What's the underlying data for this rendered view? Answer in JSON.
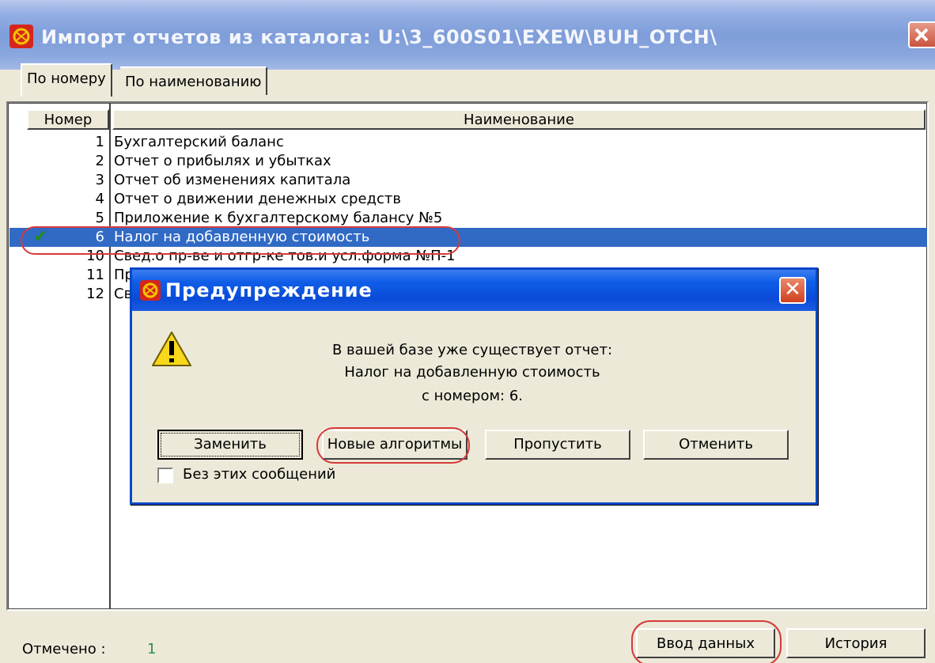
{
  "window": {
    "title": "Импорт отчетов из каталога:  U:\\3_600S01\\EXEW\\BUH_OTCH\\"
  },
  "tabs": [
    {
      "label": "По номеру",
      "active": true
    },
    {
      "label": "По наименованию",
      "active": false
    }
  ],
  "list": {
    "columns": [
      "Номер",
      "Наименование"
    ],
    "rows": [
      {
        "num": "1",
        "name": "Бухгалтерский баланс"
      },
      {
        "num": "2",
        "name": "Отчет о прибылях и убытках"
      },
      {
        "num": "3",
        "name": "Отчет об изменениях капитала"
      },
      {
        "num": "4",
        "name": "Отчет о движении денежных средств"
      },
      {
        "num": "5",
        "name": "Приложение к бухгалтерскому балансу №5"
      },
      {
        "num": "6",
        "name": "Налог на добавленную стоимость",
        "selected": true,
        "checked": true
      },
      {
        "num": "10",
        "name": "Свед.о пр-ве и отгр-ке тов.и усл.форма №П-1"
      },
      {
        "num": "11",
        "name": "Пр"
      },
      {
        "num": "12",
        "name": "Св"
      }
    ]
  },
  "status": {
    "label": "Отмечено :",
    "value": "1"
  },
  "buttons": {
    "enter": "Ввод данных",
    "history": "История"
  },
  "dialog": {
    "title": "Предупреждение",
    "message": [
      "В вашей базе уже существует отчет:",
      "Налог на добавленную стоимость",
      "с номером: 6."
    ],
    "buttons": {
      "replace": "Заменить",
      "new_algorithms": "Новые алгоритмы",
      "skip": "Пропустить",
      "cancel": "Отменить"
    },
    "checkbox_label": "Без этих сообщений"
  },
  "colors": {
    "selection": "#316ac5",
    "annotation": "#d63a3a",
    "check": "#1e8e1e",
    "dialog_title": "#0a4bd8"
  }
}
